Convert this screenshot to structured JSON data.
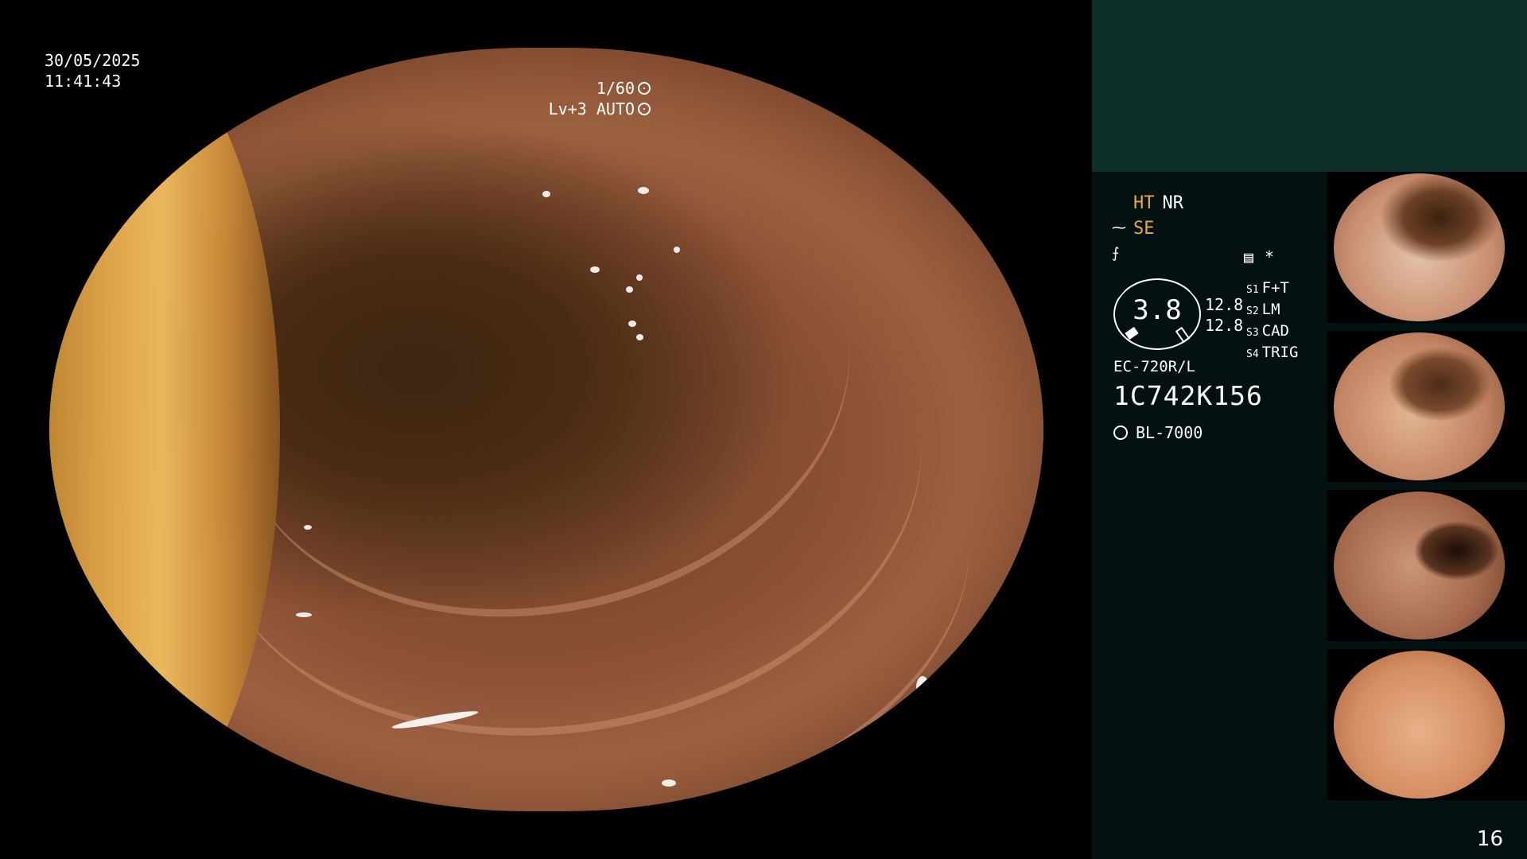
{
  "overlay": {
    "date": "30/05/2025",
    "time": "11:41:43",
    "shutter": "1/60",
    "level": "Lv+3 AUTO"
  },
  "side": {
    "mode_ht": "HT",
    "mode_nr": "NR",
    "mode_se": "SE",
    "gauge_value": "3.8",
    "gauge_num_1": "12.8",
    "gauge_num_2": "12.8",
    "slots": [
      {
        "key": "S1",
        "value": "F+T"
      },
      {
        "key": "S2",
        "value": "LM"
      },
      {
        "key": "S3",
        "value": "CAD"
      },
      {
        "key": "S4",
        "value": "TRIG"
      }
    ],
    "scope_model": "EC-720R/L",
    "serial": "1C742K156",
    "light_source": "BL-7000",
    "star": "*",
    "icons": [
      "film-icon",
      "sparkle-icon",
      "waveform-icon",
      "sun-icon",
      "dial-icon"
    ],
    "accent_color": "#e9a83c"
  },
  "page_number": "16"
}
